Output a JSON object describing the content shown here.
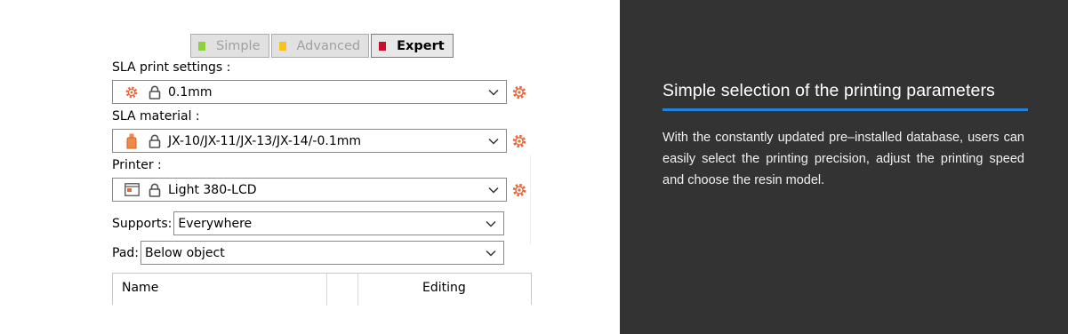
{
  "modes": {
    "simple": "Simple",
    "advanced": "Advanced",
    "expert": "Expert",
    "colors": {
      "simple": "#8bd13a",
      "advanced": "#f3c51a",
      "expert": "#c8102e"
    },
    "selected": "Expert"
  },
  "print_settings": {
    "label": "SLA print settings :",
    "value": "0.1mm",
    "icon": "gear-icon"
  },
  "material": {
    "label": "SLA material :",
    "value": "JX-10/JX-11/JX-13/JX-14/-0.1mm",
    "icon": "resin-bottle-icon"
  },
  "printer": {
    "label": "Printer :",
    "value": "Light 380-LCD",
    "icon": "printer-icon"
  },
  "supports": {
    "label": "Supports:",
    "value": "Everywhere"
  },
  "pad": {
    "label": "Pad:",
    "value": "Below object"
  },
  "table": {
    "headers": [
      "Name",
      "Editing"
    ]
  },
  "feature": {
    "title": "Simple selection of the printing parameters",
    "description": "With the constantly updated pre–installed database, users can easily select the printing precision, adjust the printing speed and choose the resin model.",
    "accent": "#1f83e0"
  }
}
